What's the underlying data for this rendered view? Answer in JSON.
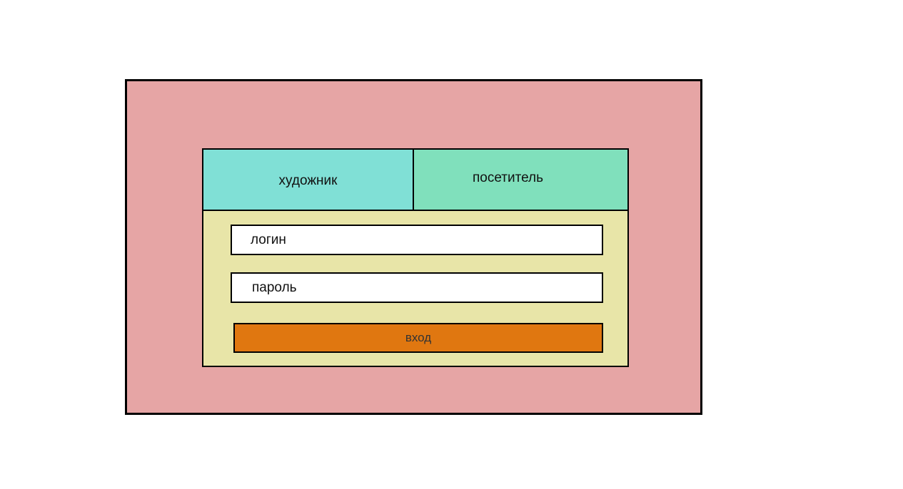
{
  "colors": {
    "frame_background": "#e6a5a5",
    "panel_background": "#e8e5a8",
    "tab_artist": "#80e0d6",
    "tab_visitor": "#80e0bc",
    "button": "#e07710"
  },
  "tabs": {
    "artist_label": "художник",
    "visitor_label": "посетитель"
  },
  "form": {
    "login_placeholder": "логин",
    "password_placeholder": "пароль",
    "submit_label": "вход"
  }
}
